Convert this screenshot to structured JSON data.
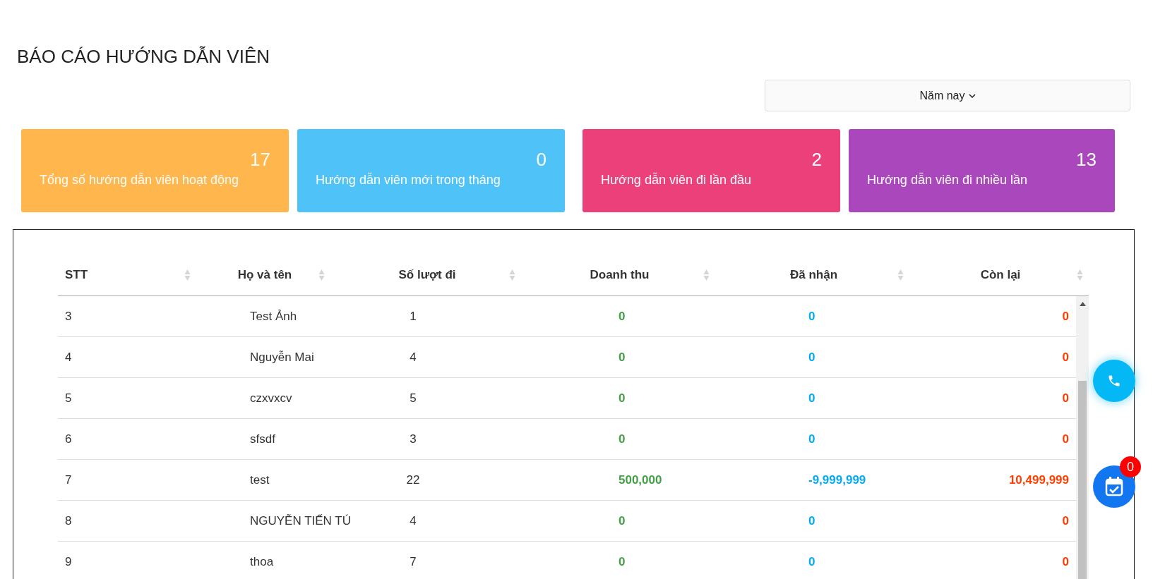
{
  "title": "BÁO CÁO HƯỚNG DẪN VIÊN",
  "period_dropdown": {
    "label": "Năm nay"
  },
  "stat_cards": [
    {
      "value": "17",
      "label": "Tổng số hướng dẫn viên hoạt động",
      "color": "#ffb64d"
    },
    {
      "value": "0",
      "label": "Hướng dẫn viên mới trong tháng",
      "color": "#4fc3f7"
    },
    {
      "value": "2",
      "label": "Hướng dẫn viên đi lần đầu",
      "color": "#ec407a"
    },
    {
      "value": "13",
      "label": "Hướng dẫn viên đi nhiều lần",
      "color": "#ab47bc"
    }
  ],
  "table": {
    "columns": [
      "STT",
      "Họ và tên",
      "Số lượt đi",
      "Doanh thu",
      "Đã nhận",
      "Còn lại"
    ],
    "rows": [
      [
        "3",
        "Test Ảnh",
        "1",
        "0",
        "0",
        "0"
      ],
      [
        "4",
        "Nguyễn Mai",
        "4",
        "0",
        "0",
        "0"
      ],
      [
        "5",
        "czxvxcv",
        "5",
        "0",
        "0",
        "0"
      ],
      [
        "6",
        "sfsdf",
        "3",
        "0",
        "0",
        "0"
      ],
      [
        "7",
        "test",
        "22",
        "500,000",
        "-9,999,999",
        "10,499,999"
      ],
      [
        "8",
        "NGUYỄN TIẾN TÚ",
        "4",
        "0",
        "0",
        "0"
      ],
      [
        "9",
        "thoa",
        "7",
        "0",
        "0",
        "0"
      ]
    ]
  },
  "calendar_badge": "0"
}
